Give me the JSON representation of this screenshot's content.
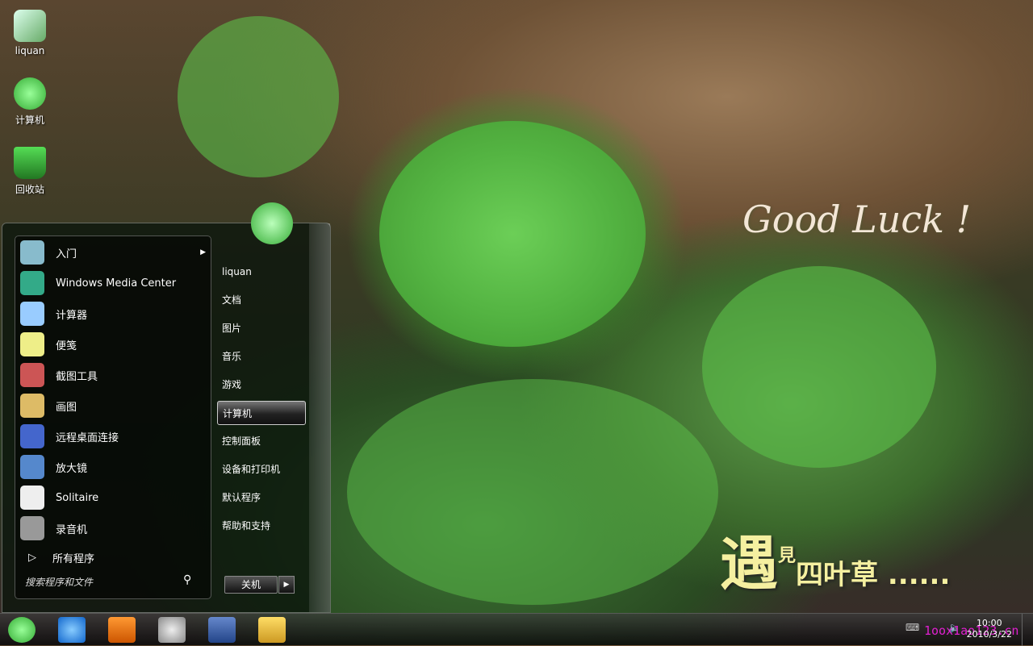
{
  "desktop": {
    "icons": [
      {
        "label": "liquan",
        "icon": "user-folder-icon"
      },
      {
        "label": "计算机",
        "icon": "computer-clover-icon"
      },
      {
        "label": "回收站",
        "icon": "recycle-bin-icon"
      }
    ]
  },
  "wallpaper": {
    "text1": "Good Luck !",
    "text2_big": "遇",
    "text2_small": "見",
    "text2_rest": "四叶草 ......"
  },
  "start_menu": {
    "programs": [
      {
        "label": "入门",
        "icon": "getting-started-icon",
        "has_submenu": true
      },
      {
        "label": "Windows Media Center",
        "icon": "media-center-icon"
      },
      {
        "label": "计算器",
        "icon": "calculator-icon"
      },
      {
        "label": "便笺",
        "icon": "sticky-notes-icon"
      },
      {
        "label": "截图工具",
        "icon": "snipping-tool-icon"
      },
      {
        "label": "画图",
        "icon": "paint-icon"
      },
      {
        "label": "远程桌面连接",
        "icon": "remote-desktop-icon"
      },
      {
        "label": "放大镜",
        "icon": "magnifier-icon"
      },
      {
        "label": "Solitaire",
        "icon": "solitaire-icon"
      },
      {
        "label": "录音机",
        "icon": "sound-recorder-icon"
      }
    ],
    "all_programs": "所有程序",
    "search_placeholder": "搜索程序和文件",
    "places": [
      "liquan",
      "文档",
      "图片",
      "音乐",
      "游戏",
      "计算机",
      "控制面板",
      "设备和打印机",
      "默认程序",
      "帮助和支持"
    ],
    "selected_place": "计算机",
    "shutdown": "关机"
  },
  "taskbar": {
    "apps": [
      "start-clover-icon",
      "internet-explorer-icon",
      "media-player-icon",
      "snipping-tool-icon",
      "app-icon",
      "explorer-folder-icon"
    ],
    "time": "10:00",
    "date": "2010/3/22",
    "watermark": "1oox1ao123.cn"
  },
  "colors": {
    "menu_bg": "#0a140c",
    "slogan": "#f5f0a0",
    "watermark": "#e020d0"
  }
}
